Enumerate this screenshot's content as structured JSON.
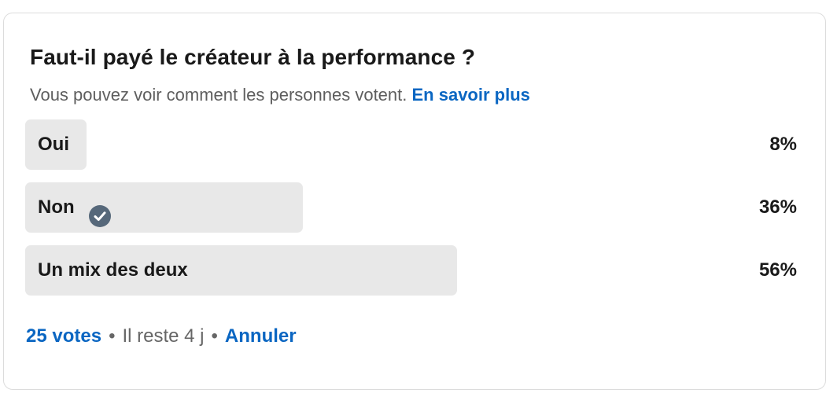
{
  "poll": {
    "question": "Faut-il payé le créateur à la performance ?",
    "subtitle": "Vous pouvez voir comment les personnes votent.",
    "learn_more": "En savoir plus",
    "options": [
      {
        "label": "Oui",
        "percent_text": "8%",
        "percent": 8,
        "selected": false
      },
      {
        "label": "Non",
        "percent_text": "36%",
        "percent": 36,
        "selected": true
      },
      {
        "label": "Un mix des deux",
        "percent_text": "56%",
        "percent": 56,
        "selected": false
      }
    ],
    "votes": "25 votes",
    "separator": "•",
    "time_left": "Il reste 4 j",
    "cancel": "Annuler"
  },
  "colors": {
    "accent": "#0a66c2",
    "bar_fill": "#e8e8e8",
    "check_badge": "#56687a"
  },
  "icons": {
    "selected_mark": "check-circle-icon"
  }
}
